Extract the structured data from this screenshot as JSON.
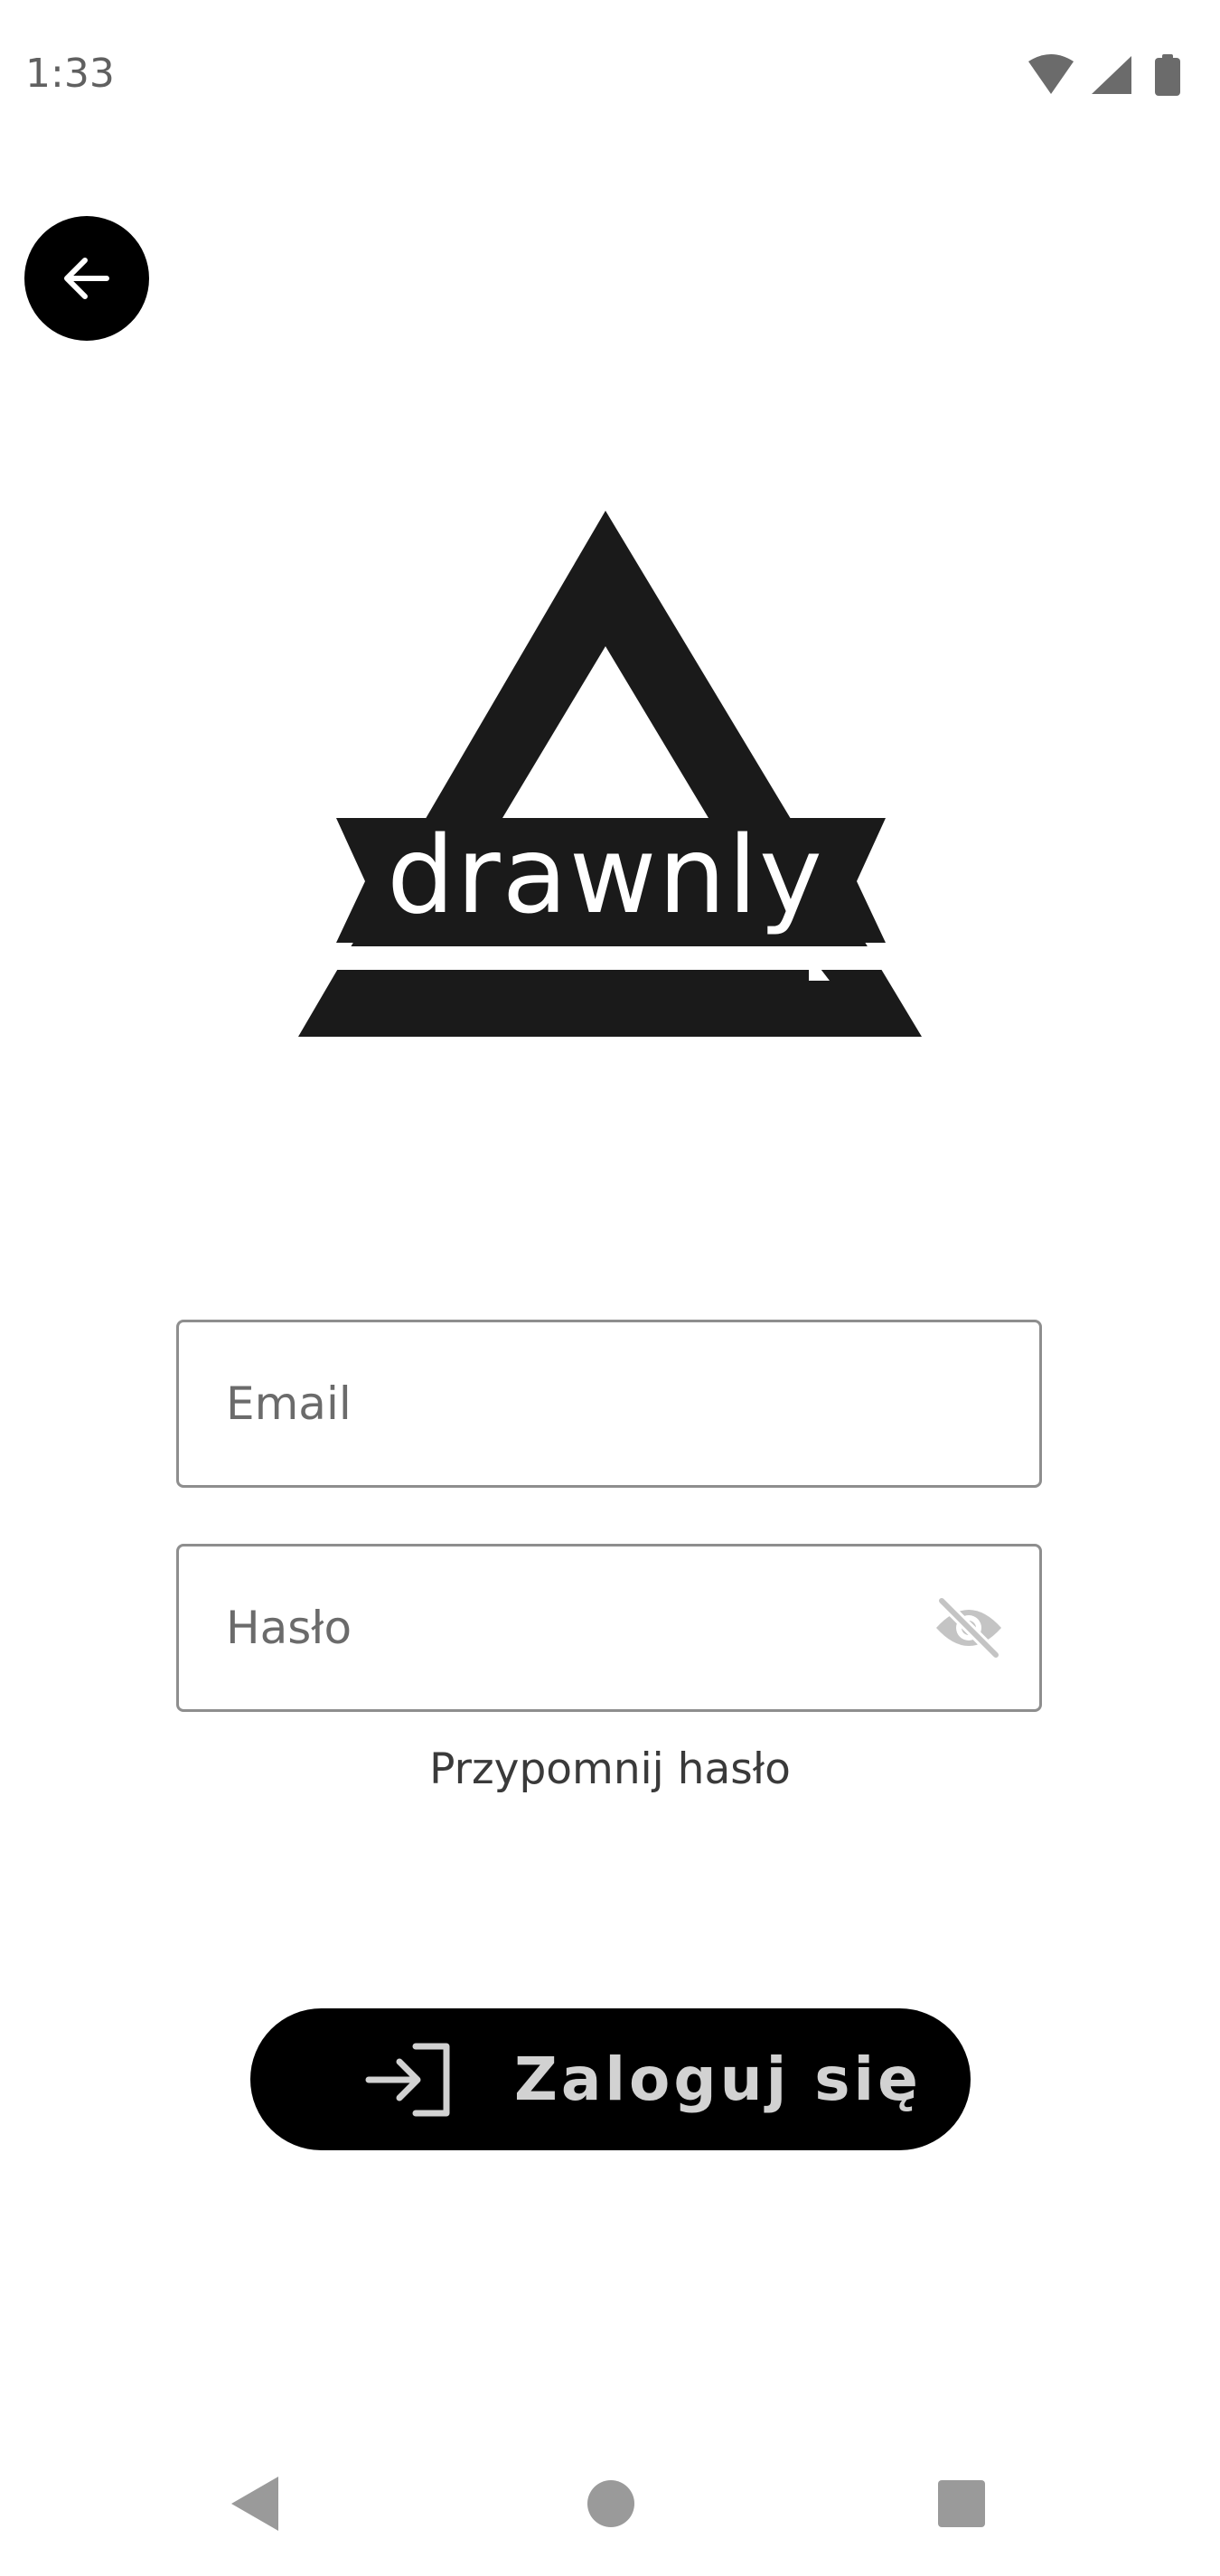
{
  "status_bar": {
    "time": "1:33",
    "icons": [
      "wifi-icon",
      "signal-icon",
      "battery-icon"
    ],
    "icon_color": "#6b6b6b"
  },
  "header": {
    "back_button_icon": "arrow-left-icon"
  },
  "logo": {
    "text": "drawnly",
    "color": "#1a1a1a"
  },
  "form": {
    "email_placeholder": "Email",
    "email_value": "",
    "password_placeholder": "Hasło",
    "password_value": "",
    "password_toggle_icon": "eye-off-icon",
    "forgot_password_label": "Przypomnij hasło"
  },
  "login_button": {
    "label": "Zaloguj się",
    "icon": "login-icon",
    "background": "#000000",
    "text_color": "#d2d2d2"
  },
  "nav_bar": {
    "icons": [
      "nav-back-icon",
      "nav-home-icon",
      "nav-recents-icon"
    ],
    "color": "#9a9a9a"
  }
}
